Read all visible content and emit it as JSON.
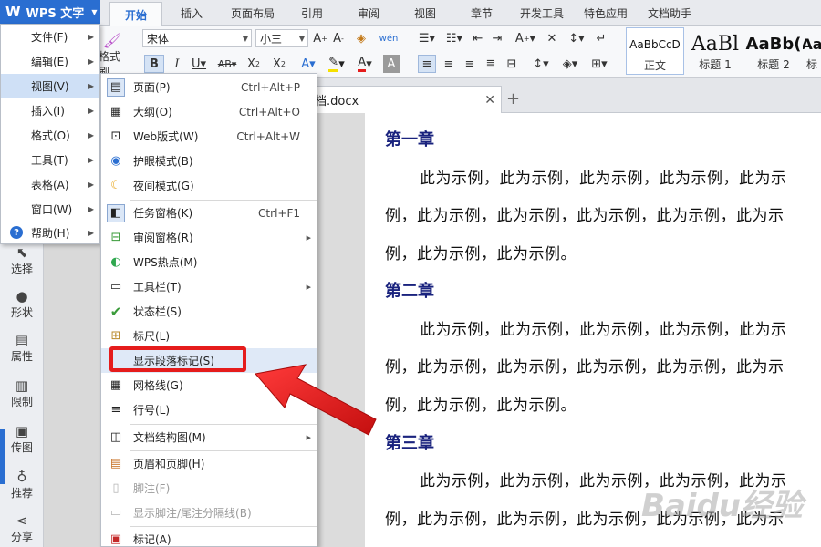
{
  "app": {
    "name": "WPS 文字"
  },
  "tabs": [
    "开始",
    "插入",
    "页面布局",
    "引用",
    "审阅",
    "视图",
    "章节",
    "开发工具",
    "特色应用",
    "文档助手"
  ],
  "ribbon": {
    "font_name": "宋体",
    "font_size": "小三",
    "format_painter_label": "格式刷",
    "styles": [
      {
        "sample": "AaBbCcD",
        "label": "正文"
      },
      {
        "sample": "AaBl",
        "label": "标题 1"
      },
      {
        "sample": "AaBb(",
        "label": "标题 2"
      },
      {
        "sample": "Aa",
        "label": "标"
      }
    ]
  },
  "document_tab": {
    "name": "档.docx"
  },
  "sidebar": {
    "items": [
      {
        "label": "选择",
        "icon": "cursor-icon"
      },
      {
        "label": "形状",
        "icon": "shapes-icon"
      },
      {
        "label": "属性",
        "icon": "properties-icon"
      },
      {
        "label": "限制",
        "icon": "restrict-icon"
      },
      {
        "label": "传图",
        "icon": "image-upload-icon"
      },
      {
        "label": "推荐",
        "icon": "recommend-icon"
      },
      {
        "label": "分享",
        "icon": "share-icon"
      }
    ]
  },
  "main_menu": {
    "items": [
      {
        "label": "文件(F)"
      },
      {
        "label": "编辑(E)"
      },
      {
        "label": "视图(V)",
        "active": true
      },
      {
        "label": "插入(I)"
      },
      {
        "label": "格式(O)"
      },
      {
        "label": "工具(T)"
      },
      {
        "label": "表格(A)"
      },
      {
        "label": "窗口(W)"
      },
      {
        "label": "帮助(H)"
      }
    ]
  },
  "view_submenu": {
    "items": [
      {
        "label": "页面(P)",
        "shortcut": "Ctrl+Alt+P",
        "icon": "page-view-icon"
      },
      {
        "label": "大纲(O)",
        "shortcut": "Ctrl+Alt+O",
        "icon": "outline-icon"
      },
      {
        "label": "Web版式(W)",
        "shortcut": "Ctrl+Alt+W",
        "icon": "web-layout-icon"
      },
      {
        "label": "护眼模式(B)",
        "shortcut": "",
        "icon": "eye-protect-icon"
      },
      {
        "label": "夜间模式(G)",
        "shortcut": "",
        "icon": "night-mode-icon"
      },
      {
        "label": "任务窗格(K)",
        "shortcut": "Ctrl+F1",
        "icon": "task-pane-icon"
      },
      {
        "label": "审阅窗格(R)",
        "shortcut": "",
        "icon": "review-pane-icon"
      },
      {
        "label": "WPS热点(M)",
        "shortcut": "",
        "icon": "wps-hotspot-icon"
      },
      {
        "label": "工具栏(T)",
        "shortcut": "",
        "icon": "toolbar-icon"
      },
      {
        "label": "状态栏(S)",
        "shortcut": "",
        "icon": "checkmark-icon"
      },
      {
        "label": "标尺(L)",
        "shortcut": "",
        "icon": "ruler-icon"
      },
      {
        "label": "显示段落标记(S)",
        "shortcut": "",
        "icon": ""
      },
      {
        "label": "网格线(G)",
        "shortcut": "",
        "icon": "grid-icon"
      },
      {
        "label": "行号(L)",
        "shortcut": "",
        "icon": "line-number-icon"
      },
      {
        "label": "文档结构图(M)",
        "shortcut": "",
        "icon": "doc-map-icon"
      },
      {
        "label": "页眉和页脚(H)",
        "shortcut": "",
        "icon": "header-footer-icon"
      },
      {
        "label": "脚注(F)",
        "shortcut": "",
        "icon": "footnote-icon"
      },
      {
        "label": "显示脚注/尾注分隔线(B)",
        "shortcut": "",
        "icon": "footnote-separator-icon"
      },
      {
        "label": "标记(A)",
        "shortcut": "",
        "icon": "markup-icon"
      }
    ]
  },
  "document": {
    "chapters": [
      {
        "title": "第一章",
        "lines": [
          "此为示例，此为示例，此为示例，此为示例，此为示",
          "例，此为示例，此为示例，此为示例，此为示例，此为示",
          "例，此为示例，此为示例。"
        ]
      },
      {
        "title": "第二章",
        "lines": [
          "此为示例，此为示例，此为示例，此为示例，此为示",
          "例，此为示例，此为示例，此为示例，此为示例，此为示",
          "例，此为示例，此为示例。"
        ]
      },
      {
        "title": "第三章",
        "lines": [
          "此为示例，此为示例，此为示例，此为示例，此为示",
          "例，此为示例，此为示例，此为示例，此为示例，此为示"
        ]
      }
    ]
  },
  "watermark_text": "Baidu经验",
  "colors": {
    "accent": "#2a6ed1",
    "callout": "#e51c1c",
    "chapter": "#1a237e"
  }
}
